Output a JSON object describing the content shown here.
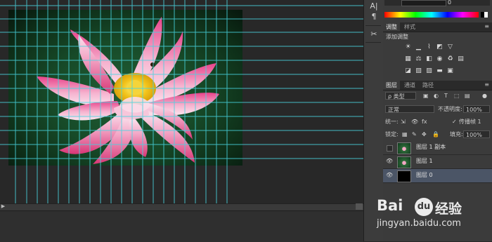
{
  "color_panel": {
    "value": "0"
  },
  "adjust_panel": {
    "tabs": [
      "调整",
      "样式"
    ],
    "title": "添加调整",
    "icons": [
      "brightness-icon",
      "levels-icon",
      "curves-icon",
      "exposure-icon",
      "vibrance-icon",
      "hue-sat-icon",
      "color-balance-icon",
      "bw-icon",
      "photo-filter-icon",
      "channel-mixer-icon",
      "color-lookup-icon",
      "invert-icon",
      "posterize-icon",
      "threshold-icon",
      "gradient-map-icon",
      "selective-color-icon"
    ]
  },
  "layers_panel": {
    "tabs": [
      "图层",
      "通道",
      "路径"
    ],
    "filter_label": "ρ 类型",
    "blend_mode": "正常",
    "opacity_label": "不透明度:",
    "opacity_value": "100%",
    "unify_label": "统一:",
    "propagate_label": "传播帧 1",
    "lock_label": "锁定:",
    "fill_label": "填充:",
    "fill_value": "100%",
    "layers": [
      {
        "name": "图层 1 副本",
        "visible": false,
        "thumb": "lotus",
        "selected": false
      },
      {
        "name": "图层 1",
        "visible": true,
        "thumb": "lotus",
        "selected": false
      },
      {
        "name": "图层 0",
        "visible": true,
        "thumb": "black",
        "selected": true
      }
    ]
  },
  "watermark": {
    "brand": "Bai",
    "paw": "du",
    "cn": "经验",
    "url": "jingyan.baidu.com"
  },
  "toolcolumn": {
    "icons": [
      "character-icon",
      "paragraph-icon",
      "tools-icon"
    ]
  }
}
